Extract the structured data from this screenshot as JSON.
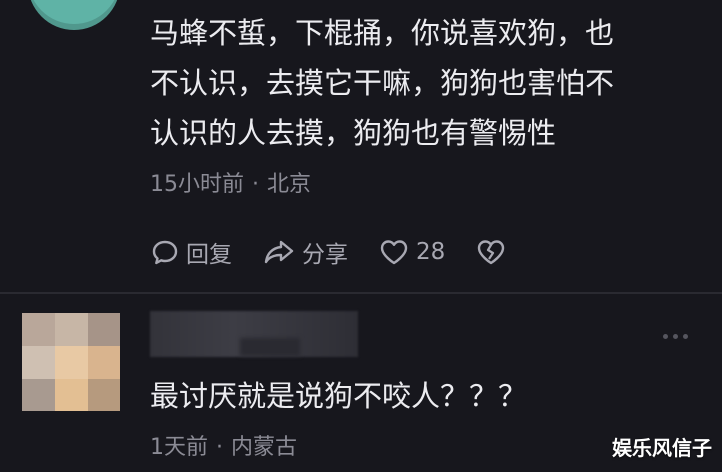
{
  "comment1": {
    "text": "马蜂不蜇，下棍捅，你说喜欢狗，也\n不认识，去摸它干嘛，狗狗也害怕不\n认识的人去摸，狗狗也有警惕性",
    "time": "15小时前",
    "location": "北京",
    "reply_label": "回复",
    "share_label": "分享",
    "like_count": "28",
    "icons": [
      "reply-icon",
      "share-icon",
      "heart-icon",
      "broken-heart-icon"
    ]
  },
  "comment2": {
    "text": "最讨厌就是说狗不咬人？？？",
    "time": "1天前",
    "location": "内蒙古"
  },
  "separator": "·",
  "watermark": "娱乐风信子",
  "colors": {
    "background": "#17171d",
    "text": "#ececf0",
    "meta": "#8b8b95",
    "avatar_top": "#5fb3a6"
  }
}
